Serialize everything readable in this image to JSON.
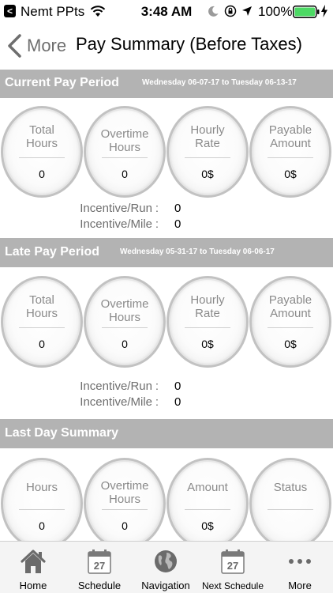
{
  "status_bar": {
    "back_app_glyph": "<",
    "carrier": "Nemt PPts",
    "time": "3:48 AM",
    "battery": "100%",
    "battery_color": "#4cd964"
  },
  "nav": {
    "back_label": "More",
    "title": "Pay Summary (Before Taxes)"
  },
  "current_period": {
    "title": "Current Pay Period",
    "dates": "Wednesday 06-07-17 to Tuesday 06-13-17",
    "circles": [
      {
        "label": "Total\nHours",
        "value": "0"
      },
      {
        "label": "Overtime\nHours",
        "value": "0"
      },
      {
        "label": "Hourly\nRate",
        "value": "0$"
      },
      {
        "label": "Payable\nAmount",
        "value": "0$"
      }
    ],
    "incentive_run_label": "Incentive/Run",
    "incentive_run_value": "0",
    "incentive_mile_label": "Incentive/Mile",
    "incentive_mile_value": "0"
  },
  "late_period": {
    "title": "Late Pay Period",
    "dates": "Wednesday 05-31-17 to Tuesday 06-06-17",
    "circles": [
      {
        "label": "Total\nHours",
        "value": "0"
      },
      {
        "label": "Overtime\nHours",
        "value": "0"
      },
      {
        "label": "Hourly\nRate",
        "value": "0$"
      },
      {
        "label": "Payable\nAmount",
        "value": "0$"
      }
    ],
    "incentive_run_label": "Incentive/Run",
    "incentive_run_value": "0",
    "incentive_mile_label": "Incentive/Mile",
    "incentive_mile_value": "0"
  },
  "last_day": {
    "title": "Last Day Summary",
    "circles": [
      {
        "label": "Hours",
        "value": "0"
      },
      {
        "label": "Overtime\nHours",
        "value": "0"
      },
      {
        "label": "Amount",
        "value": "0$"
      },
      {
        "label": "Status",
        "value": ""
      }
    ]
  },
  "tabs": [
    {
      "label": "Home",
      "icon": "home-icon"
    },
    {
      "label": "Schedule",
      "icon": "calendar-icon",
      "day": "27"
    },
    {
      "label": "Navigation",
      "icon": "globe-icon"
    },
    {
      "label": "Next Schedule",
      "icon": "calendar-icon",
      "day": "27"
    },
    {
      "label": "More",
      "icon": "more-icon"
    }
  ],
  "colors": {
    "section_header_bg": "#b3b3b3",
    "tab_icon": "#6b6b6b"
  }
}
